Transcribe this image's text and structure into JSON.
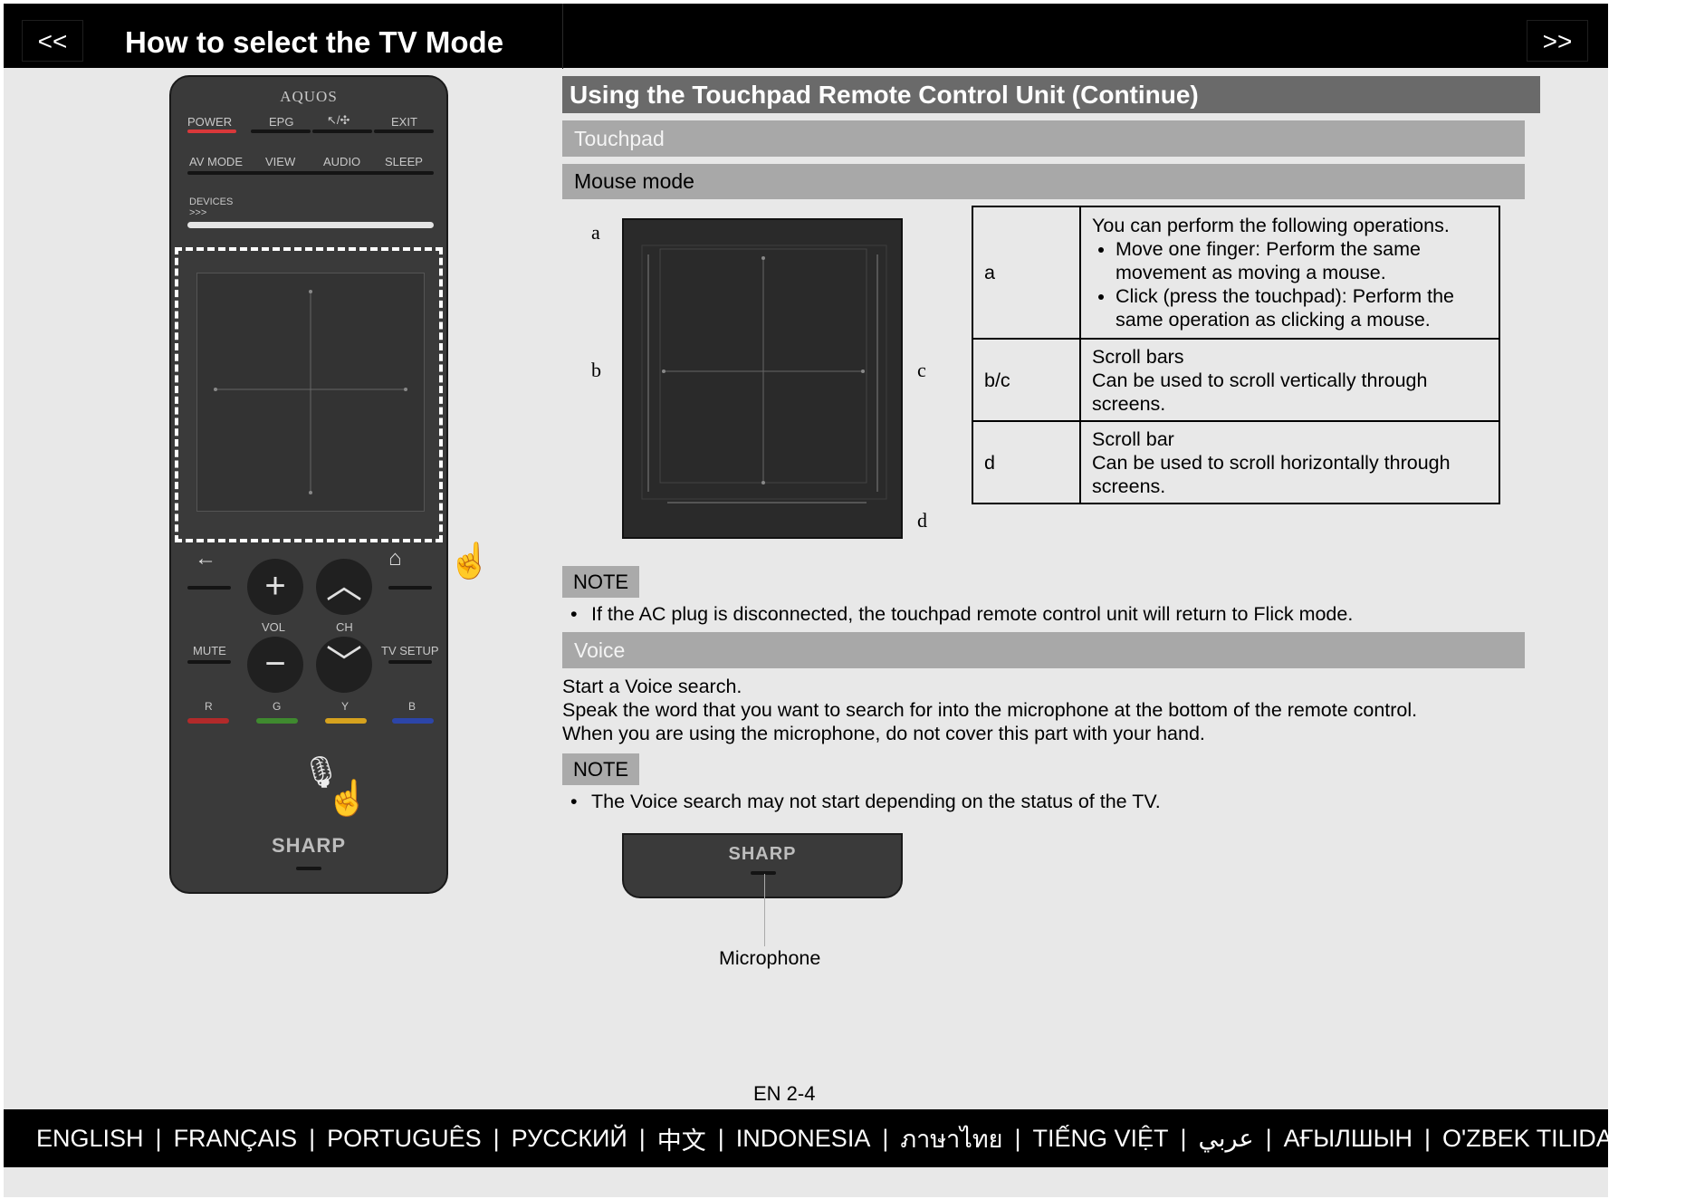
{
  "header": {
    "prev_label": "<<",
    "title": "How to select the TV Mode",
    "next_label": ">>"
  },
  "remote": {
    "top_brand": "AQUOS",
    "row1": [
      "POWER",
      "EPG",
      "EXIT"
    ],
    "row2": [
      "AV MODE",
      "VIEW",
      "AUDIO",
      "SLEEP"
    ],
    "devices": "DEVICES",
    "devices_arrows": ">>>",
    "vol": "VOL",
    "ch": "CH",
    "mute": "MUTE",
    "tv_setup": "TV SETUP",
    "color_keys": [
      "R",
      "G",
      "Y",
      "B"
    ],
    "brand": "SHARP"
  },
  "section": {
    "title": "Using the Touchpad Remote Control Unit (Continue)",
    "touchpad": "Touchpad",
    "mouse_mode": "Mouse mode"
  },
  "diagram_labels": {
    "a": "a",
    "b": "b",
    "c": "c",
    "d": "d"
  },
  "ops_table": [
    {
      "key": "a",
      "intro": "You can perform the following operations.",
      "bullets": [
        "Move one finger: Perform the same movement as moving a mouse.",
        "Click (press the touchpad): Perform the same operation as clicking a mouse."
      ]
    },
    {
      "key": "b/c",
      "title": "Scroll bars",
      "desc": "Can be used to scroll vertically through screens."
    },
    {
      "key": "d",
      "title": "Scroll bar",
      "desc": "Can be used to scroll horizontally through screens."
    }
  ],
  "note1": {
    "label": "NOTE",
    "text": "If the AC plug is disconnected, the touchpad remote control unit will return to Flick mode."
  },
  "voice": {
    "heading": "Voice",
    "lines": [
      "Start a Voice search.",
      "Speak the word that you want to search for into the microphone at the bottom of the remote control.",
      "When you are using the microphone, do not cover this part with your hand."
    ]
  },
  "note2": {
    "label": "NOTE",
    "text": "The Voice search may not start depending on the status of the TV."
  },
  "mic": {
    "brand": "SHARP",
    "caption": "Microphone"
  },
  "page_number": "EN 2-4",
  "languages": [
    "ENGLISH",
    "FRANÇAIS",
    "PORTUGUÊS",
    "РУССКИЙ",
    "中文",
    "INDONESIA",
    "ภาษาไทย",
    "TIẾNG VIỆT",
    "عربي",
    "АҒЫЛШЫН",
    "O'ZBEK TILIDA"
  ],
  "lang_separator": "|"
}
